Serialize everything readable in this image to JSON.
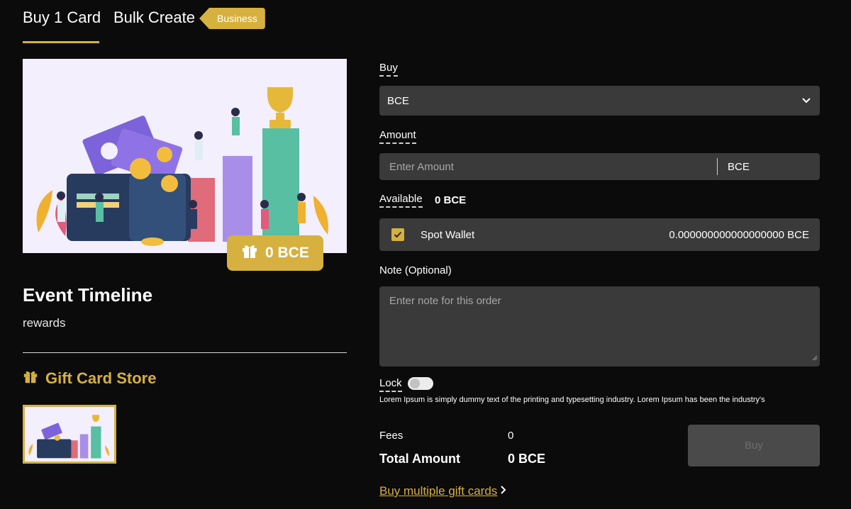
{
  "tabs": [
    {
      "label": "Buy 1 Card",
      "active": true
    },
    {
      "label": "Bulk Create",
      "active": false
    }
  ],
  "badge": "Business",
  "card": {
    "amount_pill": "0 BCE",
    "title": "Event Timeline",
    "subtitle": "rewards",
    "store_label": "Gift Card Store",
    "illustration_icon": "wallet-trophy-illustration"
  },
  "form": {
    "buy_label": "Buy",
    "currency_selected": "BCE",
    "amount_label": "Amount",
    "amount_placeholder": "Enter Amount",
    "amount_unit": "BCE",
    "available_label": "Available",
    "available_value": "0 BCE",
    "wallet_name": "Spot Wallet",
    "wallet_balance": "0.000000000000000000 BCE",
    "wallet_checked": true,
    "note_label": "Note (Optional)",
    "note_placeholder": "Enter note for this order",
    "lock_label": "Lock",
    "lock_on": false,
    "lock_description": "Lorem Ipsum is simply dummy text of the printing and typesetting industry. Lorem Ipsum has been the industry's",
    "fees_label": "Fees",
    "fees_value": "0",
    "total_label": "Total Amount",
    "total_value": "0 BCE",
    "buy_button": "Buy",
    "bulk_link": "Buy multiple gift cards"
  },
  "colors": {
    "background": "#0b0b0b",
    "accent": "#d6b13f",
    "field": "#3a3a3a"
  }
}
